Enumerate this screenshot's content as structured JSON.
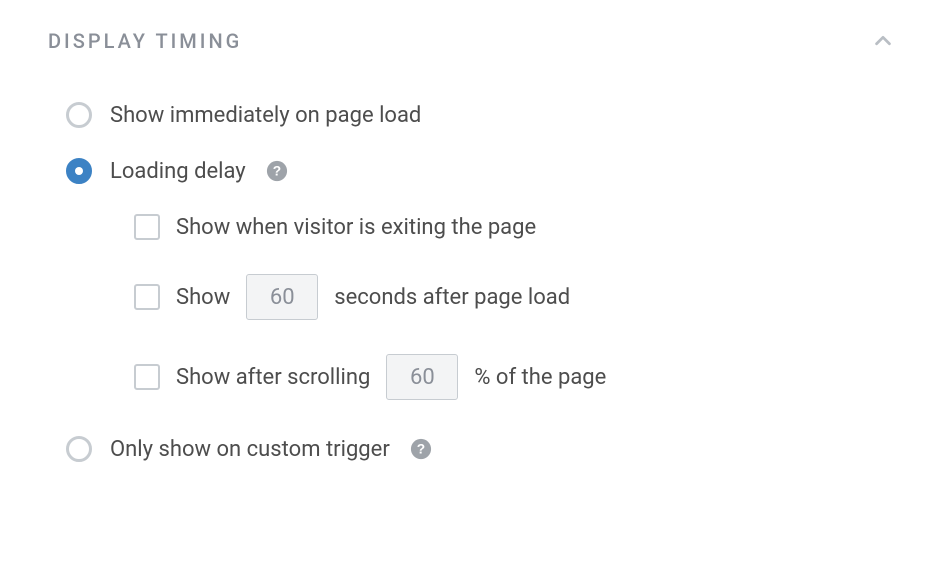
{
  "section": {
    "title": "DISPLAY TIMING"
  },
  "options": {
    "immediate": {
      "label": "Show immediately on page load",
      "selected": false
    },
    "loading_delay": {
      "label": "Loading delay",
      "selected": true,
      "sub": {
        "exit": {
          "label": "Show when visitor is exiting the page",
          "checked": false
        },
        "seconds": {
          "prefix": "Show",
          "value": "60",
          "suffix": "seconds after page load",
          "checked": false
        },
        "scroll": {
          "prefix": "Show after scrolling",
          "value": "60",
          "suffix": "% of the page",
          "checked": false
        }
      }
    },
    "custom_trigger": {
      "label": "Only show on custom trigger",
      "selected": false
    }
  }
}
